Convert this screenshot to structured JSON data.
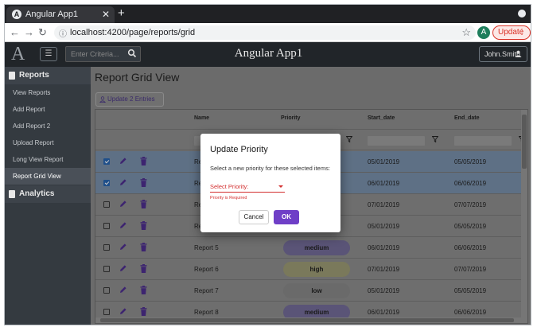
{
  "browser": {
    "tab_title": "Angular App1",
    "tab_favicon": "A",
    "url": "localhost:4200/page/reports/grid",
    "profile_initial": "A",
    "update_label": "Update",
    "update_menu": "⋮"
  },
  "header": {
    "logo": "A",
    "search_placeholder": "Enter Criteria...",
    "title": "Angular App1",
    "user": "John.Smith"
  },
  "sidebar": {
    "reports_label": "Reports",
    "items": [
      {
        "label": "View Reports"
      },
      {
        "label": "Add Report"
      },
      {
        "label": "Add Report 2"
      },
      {
        "label": "Upload Report"
      },
      {
        "label": "Long View Report"
      },
      {
        "label": "Report Grid View"
      }
    ],
    "analytics_label": "Analytics"
  },
  "main": {
    "page_title": "Report Grid View",
    "update_entries_label": "Update 2 Entries"
  },
  "grid": {
    "columns": {
      "name": "Name",
      "priority": "Priority",
      "start": "Start_date",
      "end": "End_date"
    },
    "rows": [
      {
        "name": "Rep",
        "priority": "",
        "start": "05/01/2019",
        "end": "05/05/2019",
        "selected": true
      },
      {
        "name": "Rep",
        "priority": "",
        "start": "06/01/2019",
        "end": "06/06/2019",
        "selected": true
      },
      {
        "name": "Rep",
        "priority": "",
        "start": "07/01/2019",
        "end": "07/07/2019",
        "selected": false
      },
      {
        "name": "Rep",
        "priority": "",
        "start": "05/01/2019",
        "end": "05/05/2019",
        "selected": false
      },
      {
        "name": "Report 5",
        "priority": "medium",
        "start": "06/01/2019",
        "end": "06/06/2019",
        "selected": false
      },
      {
        "name": "Report 6",
        "priority": "high",
        "start": "07/01/2019",
        "end": "07/07/2019",
        "selected": false
      },
      {
        "name": "Report 7",
        "priority": "low",
        "start": "05/01/2019",
        "end": "05/05/2019",
        "selected": false
      },
      {
        "name": "Report 8",
        "priority": "medium",
        "start": "06/01/2019",
        "end": "06/06/2019",
        "selected": false
      }
    ]
  },
  "dialog": {
    "title": "Update Priority",
    "message": "Select a new priority for these selected items:",
    "select_label": "Select Priority:",
    "error": "Priority is Required",
    "cancel": "Cancel",
    "ok": "OK"
  },
  "colors": {
    "accent": "#6f3fc7",
    "error": "#d32f2f",
    "header_bg": "#212529",
    "sidebar_bg": "#343a40"
  }
}
